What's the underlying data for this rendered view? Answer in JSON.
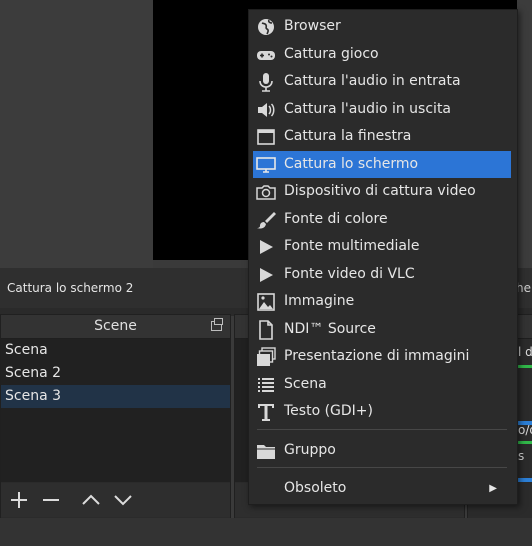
{
  "source_bar": {
    "label": "Cattura lo schermo 2",
    "edge_text": "he"
  },
  "scenes_dock": {
    "title": "Scene",
    "items": [
      "Scena",
      "Scena 2",
      "Scena 3"
    ],
    "selected_index": 2
  },
  "mixer_fragments": [
    "l d",
    "o/d",
    "s"
  ],
  "context_menu": {
    "items": [
      {
        "label": "Browser",
        "icon": "globe-icon"
      },
      {
        "label": "Cattura gioco",
        "icon": "gamepad-icon"
      },
      {
        "label": "Cattura l'audio in entrata",
        "icon": "microphone-icon"
      },
      {
        "label": "Cattura l'audio in uscita",
        "icon": "speaker-icon"
      },
      {
        "label": "Cattura la finestra",
        "icon": "window-icon"
      },
      {
        "label": "Cattura lo schermo",
        "icon": "monitor-icon",
        "highlighted": true
      },
      {
        "label": "Dispositivo di cattura video",
        "icon": "camera-icon"
      },
      {
        "label": "Fonte di colore",
        "icon": "paintbrush-icon"
      },
      {
        "label": "Fonte multimediale",
        "icon": "play-icon"
      },
      {
        "label": "Fonte video di VLC",
        "icon": "play-icon"
      },
      {
        "label": "Immagine",
        "icon": "image-icon"
      },
      {
        "label": "NDI™ Source",
        "icon": "document-icon"
      },
      {
        "label": "Presentazione di immagini",
        "icon": "slideshow-icon"
      },
      {
        "label": "Scena",
        "icon": "list-icon"
      },
      {
        "label": "Testo (GDI+)",
        "icon": "text-icon"
      }
    ],
    "group_item": {
      "label": "Gruppo",
      "icon": "folder-icon"
    },
    "deprecated_item": {
      "label": "Obsoleto",
      "submenu_arrow": "▶"
    }
  },
  "colors": {
    "highlight": "#2c75d6",
    "selected_scene": "#213347",
    "meter_green": "#31b84a"
  }
}
